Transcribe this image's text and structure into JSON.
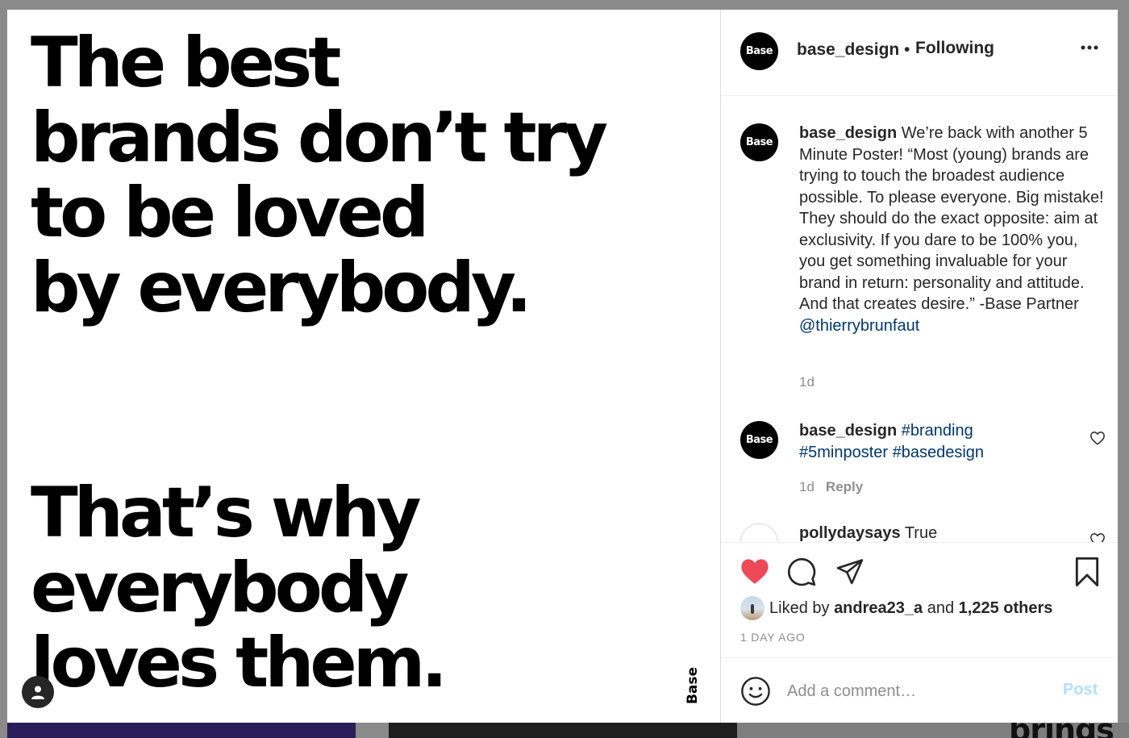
{
  "poster": {
    "headline_top": "The best\nbrands don’t try\nto be loved\nby everybody.",
    "headline_bottom": "That’s why\neverybody\nloves them.",
    "logo_text": "Base"
  },
  "post_header": {
    "avatar_text": "Base",
    "username": "base_design",
    "separator": "•",
    "follow_status": "Following"
  },
  "comments": [
    {
      "avatar_text": "Base",
      "username": "base_design",
      "text": "We’re back with another 5 Minute Poster! “Most (young) brands are trying to touch the broadest audience possible. To please everyone. Big mistake! They should do the exact opposite: aim at exclusivity. If you dare to be 100% you, you get something invaluable for your brand in return: personality and attitude. And that creates desire.” -Base Partner",
      "mention": "@thierrybrunfaut",
      "time": "1d"
    },
    {
      "avatar_text": "Base",
      "username": "base_design",
      "hashtags": "#branding #5minposter #basedesign",
      "time": "1d",
      "reply_label": "Reply"
    },
    {
      "username": "pollydaysays",
      "text": "True"
    }
  ],
  "likes": {
    "prefix": "Liked by",
    "user": "andrea23_a",
    "joiner": "and",
    "others": "1,225 others"
  },
  "post_time": "1 DAY AGO",
  "add_comment": {
    "placeholder": "Add a comment…",
    "post_label": "Post"
  },
  "background_peek_text": "brings",
  "colors": {
    "heart": "#ed4956",
    "link": "#00376b",
    "post_button_disabled": "#b2dffc"
  },
  "icons": [
    "heart-icon",
    "comment-icon",
    "share-icon",
    "bookmark-icon",
    "more-icon",
    "emoji-icon",
    "user-tag-icon",
    "heart-outline-icon"
  ]
}
